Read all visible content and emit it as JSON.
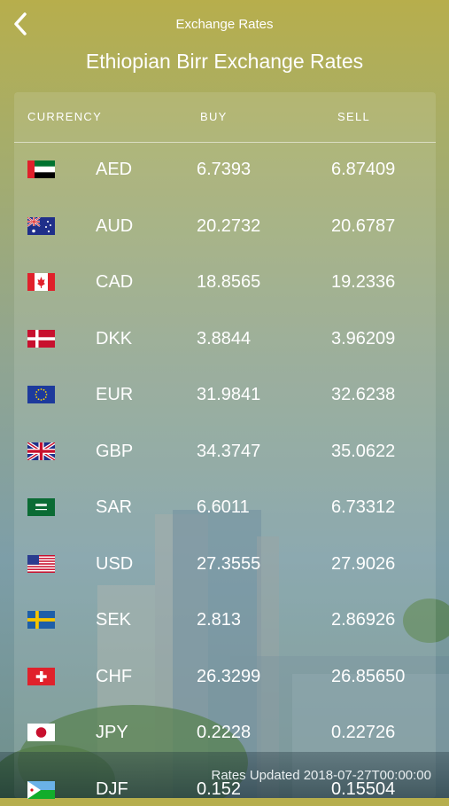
{
  "nav": {
    "title": "Exchange Rates",
    "back_icon": "chevron-left-icon"
  },
  "page": {
    "title": "Ethiopian Birr Exchange Rates"
  },
  "table": {
    "headers": {
      "currency": "CURRENCY",
      "buy": "BUY",
      "sell": "SELL"
    },
    "rows": [
      {
        "code": "AED",
        "buy": "6.7393",
        "sell": "6.87409",
        "flag": "uae-flag-icon"
      },
      {
        "code": "AUD",
        "buy": "20.2732",
        "sell": "20.6787",
        "flag": "australia-flag-icon"
      },
      {
        "code": "CAD",
        "buy": "18.8565",
        "sell": "19.2336",
        "flag": "canada-flag-icon"
      },
      {
        "code": "DKK",
        "buy": "3.8844",
        "sell": "3.96209",
        "flag": "denmark-flag-icon"
      },
      {
        "code": "EUR",
        "buy": "31.9841",
        "sell": "32.6238",
        "flag": "eu-flag-icon"
      },
      {
        "code": "GBP",
        "buy": "34.3747",
        "sell": "35.0622",
        "flag": "uk-flag-icon"
      },
      {
        "code": "SAR",
        "buy": "6.6011",
        "sell": "6.73312",
        "flag": "saudi-flag-icon"
      },
      {
        "code": "USD",
        "buy": "27.3555",
        "sell": "27.9026",
        "flag": "usa-flag-icon"
      },
      {
        "code": "SEK",
        "buy": "2.813",
        "sell": "2.86926",
        "flag": "sweden-flag-icon"
      },
      {
        "code": "CHF",
        "buy": "26.3299",
        "sell": "26.85650",
        "flag": "switzerland-flag-icon"
      },
      {
        "code": "JPY",
        "buy": "0.2228",
        "sell": "0.22726",
        "flag": "japan-flag-icon"
      }
    ],
    "partial_row": {
      "code": "DJF",
      "buy": "0.152",
      "sell": "0.15504",
      "flag": "djibouti-flag-icon"
    }
  },
  "footer": {
    "updated": "Rates Updated 2018-07-27T00:00:00"
  }
}
